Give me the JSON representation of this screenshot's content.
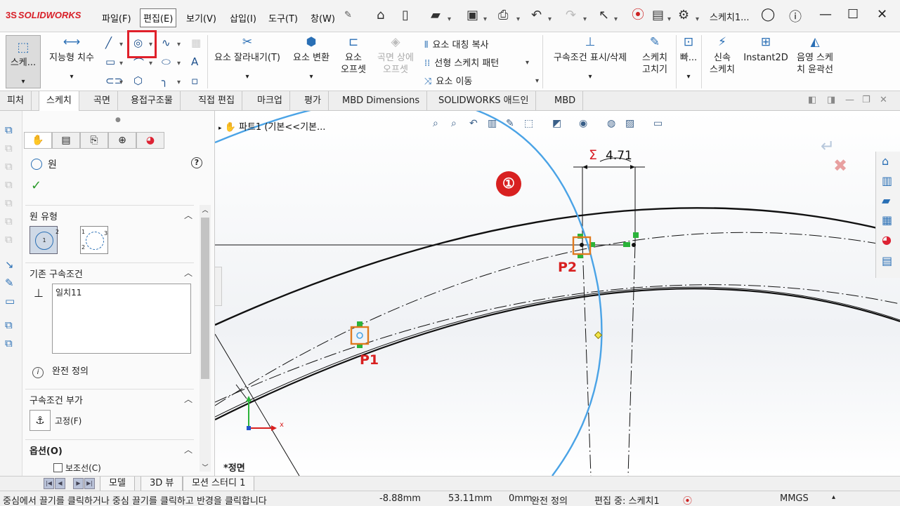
{
  "app": {
    "logo": "SOLIDWORKS",
    "logo_mark": "3S"
  },
  "menu": [
    "파일(F)",
    "편집(E)",
    "보기(V)",
    "삽입(I)",
    "도구(T)",
    "창(W)"
  ],
  "menu_active_index": 1,
  "document_title": "스케치1...",
  "command_manager": {
    "sketch": "스케...",
    "smart_dimension": "지능형 치수",
    "trim": "요소 잘라내기(T)",
    "convert": "요소 변환",
    "offset_line1": "요소",
    "offset_line2": "오프셋",
    "surface_offset_line1": "곡면 상에",
    "surface_offset_line2": "오프셋",
    "mirror": "요소 대칭 복사",
    "linear_pattern": "선형 스케치 패턴",
    "move": "요소 이동",
    "relations": "구속조건 표시/삭제",
    "repair_line1": "스케치",
    "repair_line2": "고치기",
    "quick": "빠...",
    "rapid_line1": "신속",
    "rapid_line2": "스케치",
    "instant2d": "Instant2D",
    "shaded_line1": "음영 스케",
    "shaded_line2": "치 윤곽선"
  },
  "tabs": [
    "피처",
    "스케치",
    "곡면",
    "용접구조물",
    "직접 편집",
    "마크업",
    "평가",
    "MBD Dimensions",
    "SOLIDWORKS 애드인",
    "MBD"
  ],
  "active_tab": "스케치",
  "property_manager": {
    "title": "원",
    "help": "?",
    "sections": {
      "circle_type": "원 유형",
      "existing_relations": "기존 구속조건",
      "add_relations": "구속조건 부가",
      "options": "옵션(O)"
    },
    "relations_list": [
      "일치11"
    ],
    "status": "완전 정의",
    "fix_label": "고정(F)",
    "construction_label": "보조선(C)",
    "type_icon_labels": {
      "center_a": "1",
      "center_b": "2",
      "perim_a": "1",
      "perim_b": "2",
      "perim_c": "3"
    }
  },
  "graphics": {
    "breadcrumb": "파트1  (기본<<기본...",
    "view_label": "*정면",
    "dimension_value": "4.71",
    "dimension_sigma": "Σ",
    "callout_number": "①",
    "point_labels": {
      "p1": "P1",
      "p2": "P2"
    },
    "triad_x": "x"
  },
  "bottom_tabs": [
    "모델",
    "3D 뷰",
    "모션 스터디 1"
  ],
  "status_bar": {
    "hint": "중심에서 끌기를 클릭하거나 중심 끌기를 클릭하고 반경을 클릭합니다",
    "x": "-8.88mm",
    "y": "53.11mm",
    "z": "0mm",
    "definition": "완전 정의",
    "editing": "편집 중: 스케치1",
    "units": "MMGS"
  },
  "colors": {
    "brand_red": "#d81e27",
    "selection_blue": "#4aa3e6",
    "highlight_orange": "#e07a1f",
    "relation_green": "#2bb33a"
  }
}
